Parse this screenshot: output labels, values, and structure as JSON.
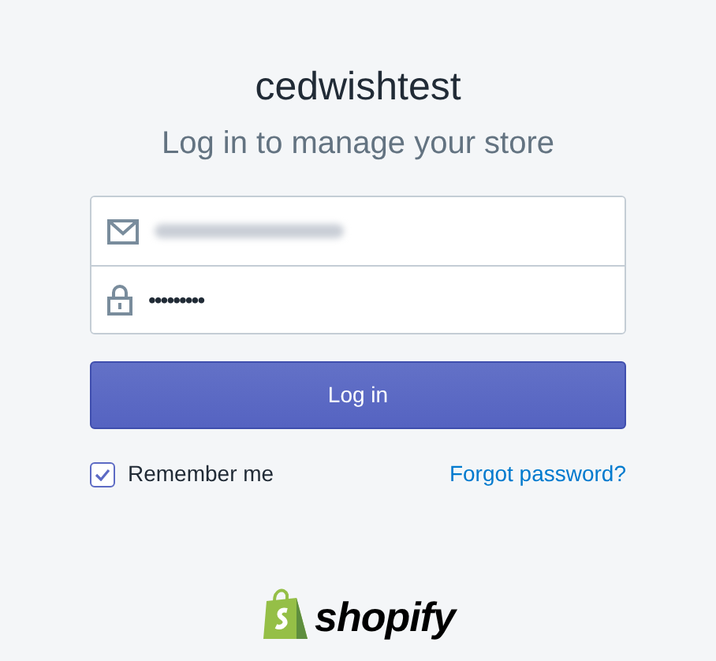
{
  "title": "cedwishtest",
  "subtitle": "Log in to manage your store",
  "fields": [
    {
      "kind": "email",
      "redacted": true
    },
    {
      "kind": "password",
      "value": "•••••••••"
    }
  ],
  "login_button": "Log in",
  "remember": {
    "label": "Remember me",
    "checked": true
  },
  "forgot_link": "Forgot password?",
  "logo": {
    "wordmark": "shopify"
  }
}
